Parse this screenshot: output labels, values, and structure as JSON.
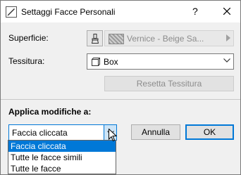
{
  "window": {
    "title": "Settaggi Facce Personali",
    "help_label": "?"
  },
  "surface": {
    "label": "Superficie:",
    "value": "Vernice - Beige Sa..."
  },
  "texture": {
    "label": "Tessitura:",
    "value": "Box"
  },
  "reset_button": "Resetta Tessitura",
  "apply": {
    "label": "Applica modifiche a:",
    "selected": "Faccia cliccata",
    "options": [
      "Faccia cliccata",
      "Tutte le facce simili",
      "Tutte le facce"
    ]
  },
  "buttons": {
    "cancel": "Annulla",
    "ok": "OK"
  },
  "colors": {
    "accent": "#0078d7",
    "disabled_text": "#8c8c8c"
  }
}
